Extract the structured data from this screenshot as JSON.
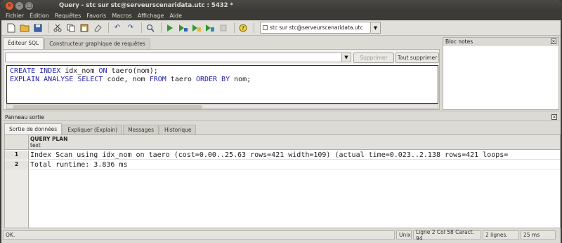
{
  "window": {
    "title": "Query - stc sur stc@serveurscenaridata.utc : 5432 *"
  },
  "menu": [
    "Fichier",
    "Édition",
    "Requêtes",
    "Favoris",
    "Macros",
    "Affichage",
    "Aide"
  ],
  "toolbar": {
    "icons": [
      "new-file",
      "open-folder",
      "save",
      "cut",
      "copy",
      "paste",
      "clear",
      "undo",
      "redo",
      "find",
      "execute",
      "execute-pgscript",
      "explain",
      "explain-analyze",
      "cancel",
      "help"
    ],
    "connection": "stc sur stc@serveurscenaridata.utc"
  },
  "sql_editor": {
    "tabs": [
      {
        "label": "Éditeur SQL",
        "active": true
      },
      {
        "label": "Constructeur graphique de requêtes",
        "active": false
      }
    ],
    "delete_label": "Supprimer",
    "delete_all_label": "Tout supprimer",
    "lines": [
      [
        {
          "t": "CREATE INDEX",
          "k": true
        },
        {
          "t": " idx_nom ",
          "k": false
        },
        {
          "t": "ON",
          "k": true
        },
        {
          "t": " taero(nom);",
          "k": false
        }
      ],
      [
        {
          "t": "EXPLAIN ANALYSE SELECT",
          "k": true
        },
        {
          "t": " code, nom ",
          "k": false
        },
        {
          "t": "FROM",
          "k": true
        },
        {
          "t": " taero ",
          "k": false
        },
        {
          "t": "ORDER BY",
          "k": true
        },
        {
          "t": " nom;",
          "k": false
        }
      ]
    ]
  },
  "notes": {
    "title": "Bloc notes"
  },
  "output": {
    "title": "Panneau sortie",
    "tabs": [
      {
        "label": "Sortie de données",
        "active": true
      },
      {
        "label": "Expliquer (Explain)",
        "active": false
      },
      {
        "label": "Messages",
        "active": false
      },
      {
        "label": "Historique",
        "active": false
      }
    ],
    "column": {
      "name": "QUERY PLAN",
      "type": "text"
    },
    "rows": [
      {
        "num": "1",
        "text": "Index Scan using idx_nom on taero  (cost=0.00..25.63 rows=421 width=109) (actual time=0.023..2.138 rows=421 loops="
      },
      {
        "num": "2",
        "text": "Total runtime: 3.836 ms"
      }
    ]
  },
  "status": {
    "message": "OK.",
    "lineending": "Unix",
    "position": "Ligne 2 Col 58 Caract. 94",
    "rows": "2 lignes.",
    "time": "25 ms"
  }
}
